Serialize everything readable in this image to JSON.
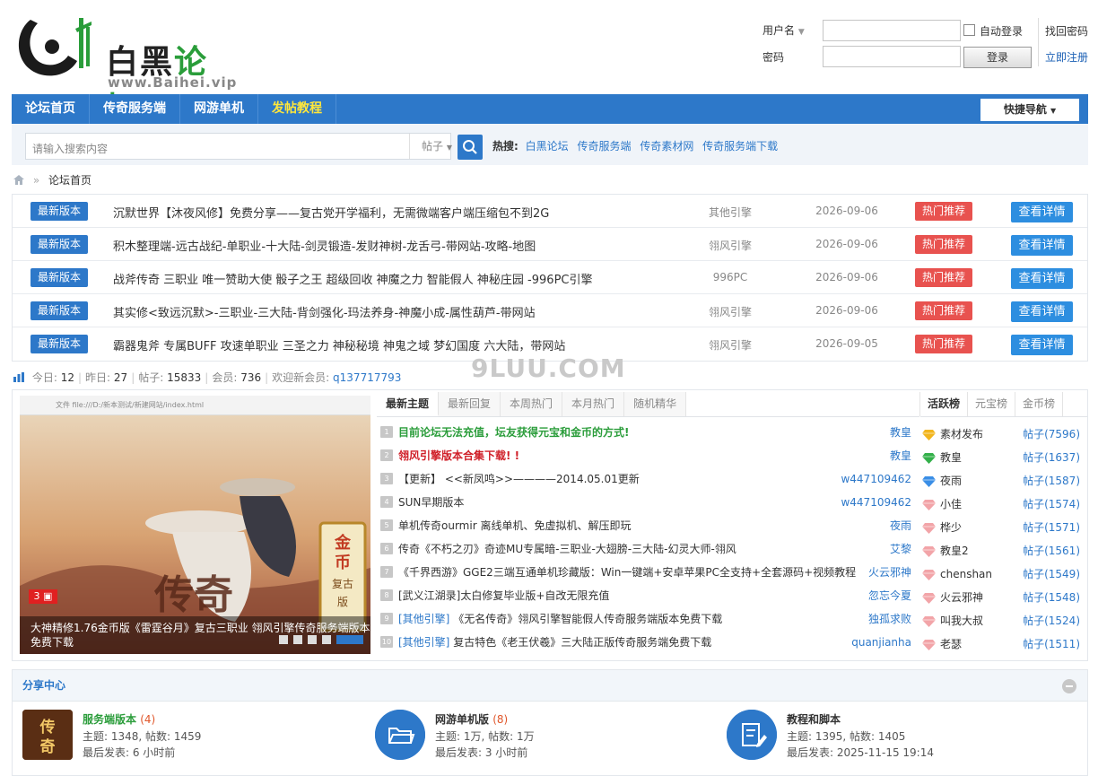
{
  "logo": {
    "title_black": "白黑",
    "title_green": "论坛",
    "url": "www.Baihei.vip"
  },
  "login": {
    "username_label": "用户名",
    "password_label": "密码",
    "auto_login": "自动登录",
    "login_button": "登录",
    "find_password": "找回密码",
    "register": "立即注册"
  },
  "nav": {
    "items": [
      "论坛首页",
      "传奇服务端",
      "网游单机",
      "发帖教程"
    ],
    "quick": "快捷导航"
  },
  "search": {
    "placeholder": "请输入搜索内容",
    "type": "帖子",
    "hot_label": "热搜:",
    "hot_links": [
      "白黑论坛",
      "传奇服务端",
      "传奇素材网",
      "传奇服务端下载"
    ]
  },
  "breadcrumb": {
    "current": "论坛首页"
  },
  "threads": [
    {
      "tag": "最新版本",
      "title": "沉默世界【沐夜风修】免费分享——复古党开学福利，无需微端客户端压缩包不到2G",
      "engine": "其他引擎",
      "date": "2026-09-06",
      "hot": "热门推荐",
      "view": "查看详情"
    },
    {
      "tag": "最新版本",
      "title": "积木整理端-远古战纪-单职业-十大陆-剑灵锻造-发财神树-龙舌弓-带网站-攻略-地图",
      "engine": "翎风引擎",
      "date": "2026-09-06",
      "hot": "热门推荐",
      "view": "查看详情"
    },
    {
      "tag": "最新版本",
      "title": "战斧传奇 三职业 唯一赞助大使 骰子之王 超级回收 神魔之力 智能假人 神秘庄园 -996PC引擎",
      "engine": "996PC",
      "date": "2026-09-06",
      "hot": "热门推荐",
      "view": "查看详情"
    },
    {
      "tag": "最新版本",
      "title": "其实修<致远沉默>-三职业-三大陆-背剑强化-玛法养身-神魔小成-属性葫芦-带网站",
      "engine": "翎风引擎",
      "date": "2026-09-06",
      "hot": "热门推荐",
      "view": "查看详情"
    },
    {
      "tag": "最新版本",
      "title": "霸器鬼斧 专属BUFF 攻速单职业 三圣之力 神秘秘境 神鬼之域 梦幻国度 六大陆，带网站",
      "engine": "翎风引擎",
      "date": "2026-09-05",
      "hot": "热门推荐",
      "view": "查看详情"
    }
  ],
  "stats": {
    "today_label": "今日:",
    "today": "12",
    "yesterday_label": "昨日:",
    "yesterday": "27",
    "posts_label": "帖子:",
    "posts": "15833",
    "members_label": "会员:",
    "members": "736",
    "welcome_label": "欢迎新会员:",
    "new_member": "q137717793"
  },
  "watermark": "9LUU.COM",
  "slider": {
    "browser_bar": "文件  file:///D:/新本测试/新建网站/index.html",
    "badge": "3",
    "caption": "大神精修1.76金币版《雷霆谷月》复古三职业 翎风引擎传奇服务端版本免费下载"
  },
  "tabs": [
    "最新主题",
    "最新回复",
    "本周热门",
    "本月热门",
    "随机精华"
  ],
  "topic_list": [
    {
      "n": "1",
      "title": "目前论坛无法充值，坛友获得元宝和金币的方式!",
      "style": "green",
      "cat": "",
      "author": "教皇"
    },
    {
      "n": "2",
      "title": "翎风引擎版本合集下载! !",
      "style": "red",
      "cat": "",
      "author": "教皇"
    },
    {
      "n": "3",
      "title": "【更新】 <<新凤鸣>>————2014.05.01更新",
      "style": "",
      "cat": "",
      "author": "w447109462"
    },
    {
      "n": "4",
      "title": "SUN早期版本",
      "style": "",
      "cat": "",
      "author": "w447109462"
    },
    {
      "n": "5",
      "title": "单机传奇ourmir 离线单机、免虚拟机、解压即玩",
      "style": "",
      "cat": "",
      "author": "夜雨"
    },
    {
      "n": "6",
      "title": "传奇《不朽之刃》奇迹MU专属暗-三职业-大翅膀-三大陆-幻灵大师-翎风",
      "style": "",
      "cat": "",
      "author": "艾黎"
    },
    {
      "n": "7",
      "title": "《千界西游》GGE2三端互通单机珍藏版：Win一键端+安卓苹果PC全支持+全套源码+视频教程",
      "style": "",
      "cat": "",
      "author": "火云邪神"
    },
    {
      "n": "8",
      "title": "[武义江湖录]太白修复毕业版+自改无限充值",
      "style": "",
      "cat": "",
      "author": "忽忘今夏"
    },
    {
      "n": "9",
      "title": " 《无名传奇》翎风引擎智能假人传奇服务端版本免费下载",
      "style": "",
      "cat": "[其他引擎]",
      "author": "独孤求败"
    },
    {
      "n": "10",
      "title": " 复古特色《老王伏羲》三大陆正版传奇服务端免费下载",
      "style": "",
      "cat": "[其他引擎]",
      "author": "quanjianha"
    }
  ],
  "rank_tabs": [
    "活跃榜",
    "元宝榜",
    "金币榜"
  ],
  "ranks": [
    {
      "name": "素材发布",
      "count": "帖子(7596)",
      "gem": "#f2b51e"
    },
    {
      "name": "教皇",
      "count": "帖子(1637)",
      "gem": "#33b04a"
    },
    {
      "name": "夜雨",
      "count": "帖子(1587)",
      "gem": "#3a8ee6"
    },
    {
      "name": "小佳",
      "count": "帖子(1574)",
      "gem": "#f2a4a8"
    },
    {
      "name": "桦少",
      "count": "帖子(1571)",
      "gem": "#f2a4a8"
    },
    {
      "name": "教皇2",
      "count": "帖子(1561)",
      "gem": "#f2a4a8"
    },
    {
      "name": "chenshan",
      "count": "帖子(1549)",
      "gem": "#f2a4a8"
    },
    {
      "name": "火云邪神",
      "count": "帖子(1548)",
      "gem": "#f2a4a8"
    },
    {
      "name": "叫我大叔",
      "count": "帖子(1524)",
      "gem": "#f2a4a8"
    },
    {
      "name": "老瑟",
      "count": "帖子(1511)",
      "gem": "#f2a4a8"
    }
  ],
  "share": {
    "title": "分享中心",
    "sections": [
      {
        "name": "服务端版本",
        "count": "(4)",
        "topics": "主题: 1348, 帖数: 1459",
        "last": "最后发表: 6 小时前"
      },
      {
        "name": "网游单机版",
        "count": "(8)",
        "topics": "主题: 1万, 帖数: 1万",
        "last": "最后发表: 3 小时前"
      },
      {
        "name": "教程和脚本",
        "count": "",
        "topics": "主题: 1395, 帖数: 1405",
        "last": "最后发表: 2025-11-15 19:14"
      }
    ]
  },
  "colors": {
    "primary": "#2d78c9",
    "hot": "#e8524f",
    "green": "#2b9d3b"
  }
}
